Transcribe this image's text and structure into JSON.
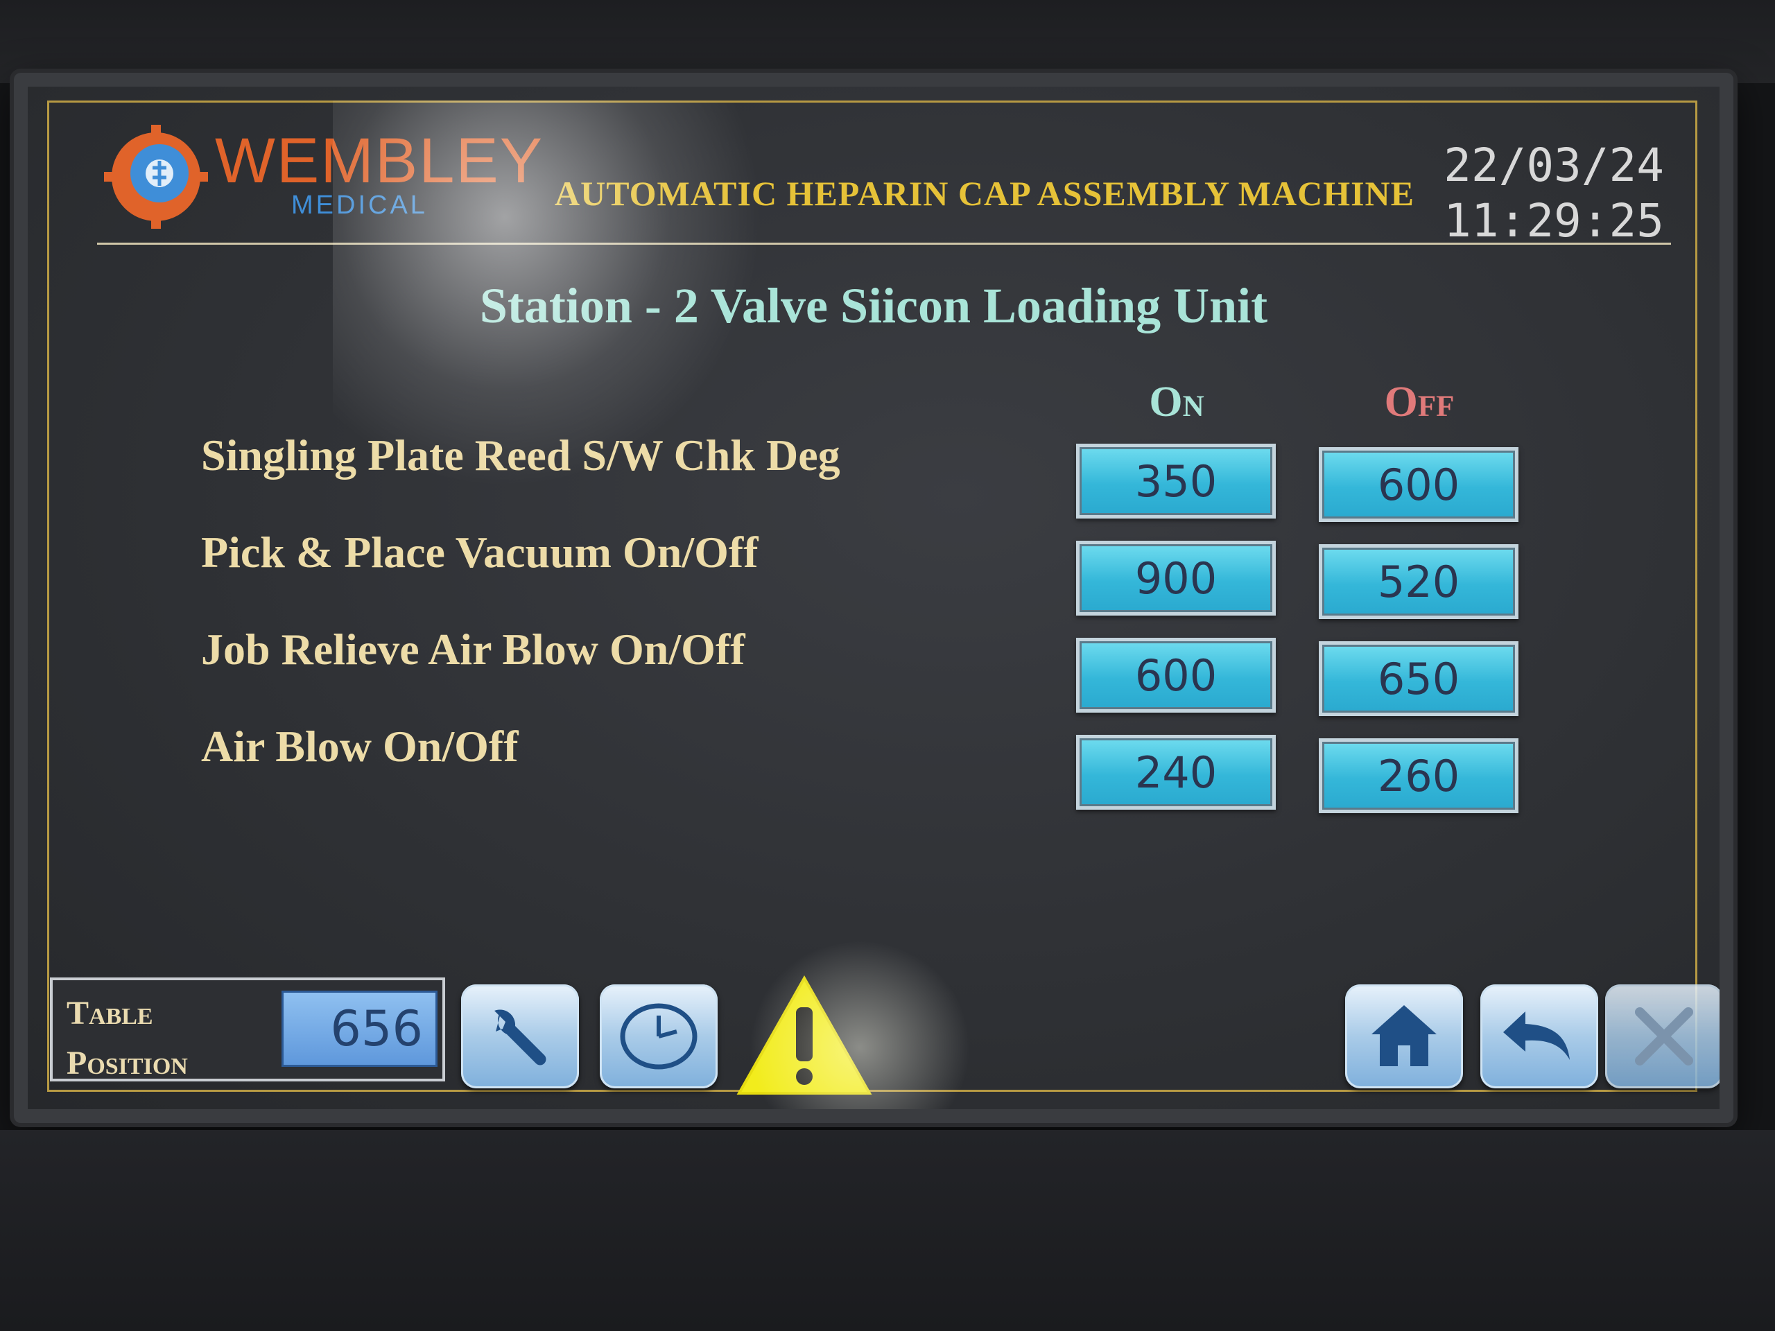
{
  "header": {
    "logo_text": "WEMBLEY",
    "logo_sub": "MEDICAL",
    "machine_title": "AUTOMATIC HEPARIN CAP ASSEMBLY MACHINE",
    "date": "22/03/24",
    "time": "11:29:25"
  },
  "station": {
    "title": "Station - 2 Valve Siicon Loading Unit",
    "col_on": "On",
    "col_off": "Off",
    "rows": [
      {
        "label": "Singling Plate Reed S/W Chk Deg",
        "on": "350",
        "off": "600"
      },
      {
        "label": "Pick & Place Vacuum On/Off",
        "on": "900",
        "off": "520"
      },
      {
        "label": "Job Relieve Air Blow On/Off",
        "on": "600",
        "off": "650"
      },
      {
        "label": "Air Blow On/Off",
        "on": "240",
        "off": "260"
      }
    ]
  },
  "footer": {
    "table_label_1": "Table",
    "table_label_2": "Position",
    "table_value": "656",
    "buttons": [
      "wrench-icon",
      "clock-icon",
      "home-icon",
      "back-icon",
      "close-icon"
    ],
    "warning": "warning-icon"
  },
  "colors": {
    "frame_gold": "#b79a43",
    "title_yellow": "#e6c238",
    "station_teal": "#a9e4d8",
    "label_cream": "#eddca8",
    "off_red": "#e07a7a",
    "value_box": "#34b7d9"
  }
}
